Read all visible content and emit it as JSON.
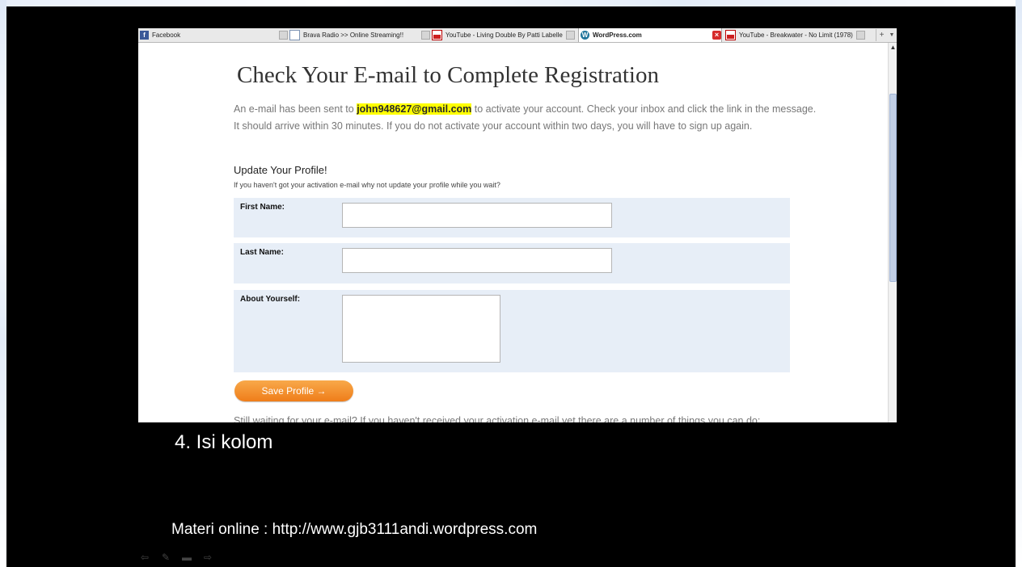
{
  "browser": {
    "tabs": [
      {
        "label": "Facebook",
        "icon": "facebook-icon"
      },
      {
        "label": "Brava Radio >> Online Streaming!!",
        "icon": "page-icon"
      },
      {
        "label": "YouTube - Living Double By Patti Labelle",
        "icon": "youtube-icon"
      },
      {
        "label": "WordPress.com",
        "icon": "wordpress-icon",
        "active": true
      },
      {
        "label": "YouTube - Breakwater - No Limit (1978)",
        "icon": "youtube-icon"
      }
    ]
  },
  "page": {
    "title": "Check Your E-mail to Complete Registration",
    "intro_before": "An e-mail has been sent to ",
    "email": "john948627@gmail.com",
    "intro_after": " to activate your account. Check your inbox and click the link in the message. It should arrive within 30 minutes. If you do not activate your account within two days, you will have to sign up again.",
    "profile_heading": "Update Your Profile!",
    "profile_sub": "If you haven't got your activation e-mail why not update your profile while you wait?",
    "fields": {
      "first_name_label": "First Name:",
      "last_name_label": "Last Name:",
      "about_label": "About Yourself:"
    },
    "save_button": "Save Profile →",
    "still_waiting": "Still waiting for your e-mail? If you haven't received your activation e-mail yet there are a number of things you can do:"
  },
  "slide": {
    "caption": "4. Isi kolom",
    "materi": "Materi online : http://www.gjb3111andi.wordpress.com"
  },
  "colors": {
    "highlight": "#ffff00",
    "button": "#ef7d1a",
    "form_row": "#e7eef7"
  }
}
